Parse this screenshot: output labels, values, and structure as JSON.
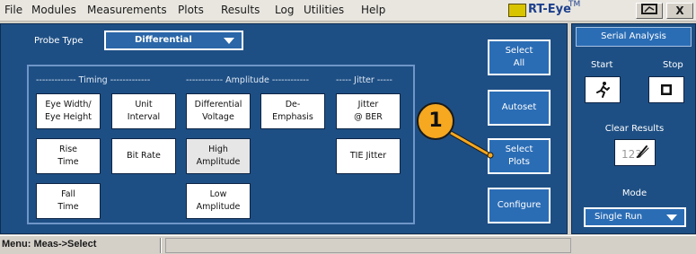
{
  "menu": {
    "items": [
      "File",
      "Modules",
      "Measurements",
      "Plots",
      "Results",
      "Log",
      "Utilities",
      "Help"
    ],
    "app_name": "RT-Eye",
    "app_tm": "TM",
    "logo_box": "XX",
    "window_buttons": [
      "▭",
      "X"
    ]
  },
  "probe": {
    "label": "Probe Type",
    "value": "Differential"
  },
  "groups": {
    "timing": "------------- Timing -------------",
    "amplitude": "------------ Amplitude ------------",
    "jitter": "----- Jitter -----"
  },
  "measurements": {
    "eye_width": "Eye Width/\nEye Height",
    "unit_interval": "Unit\nInterval",
    "differential_voltage": "Differential\nVoltage",
    "de_emphasis": "De-\nEmphasis",
    "jitter_ber": "Jitter\n@ BER",
    "rise_time": "Rise\nTime",
    "bit_rate": "Bit Rate",
    "high_amplitude": "High\nAmplitude",
    "tie_jitter": "TIE Jitter",
    "fall_time": "Fall\nTime",
    "low_amplitude": "Low\nAmplitude"
  },
  "side_buttons": {
    "select_all": "Select\nAll",
    "autoset": "Autoset",
    "select_plots": "Select\nPlots",
    "configure": "Configure"
  },
  "callout": {
    "number": "1"
  },
  "serial_analysis": {
    "title": "Serial Analysis",
    "start": "Start",
    "stop": "Stop",
    "clear_results": "Clear Results",
    "clear_glyph": "123",
    "mode_label": "Mode",
    "mode_value": "Single Run"
  },
  "status": {
    "text": "Menu: Meas->Select"
  },
  "colors": {
    "panel_blue": "#1e4f84",
    "button_blue": "#2b6db5",
    "callout_orange": "#f5a820"
  }
}
